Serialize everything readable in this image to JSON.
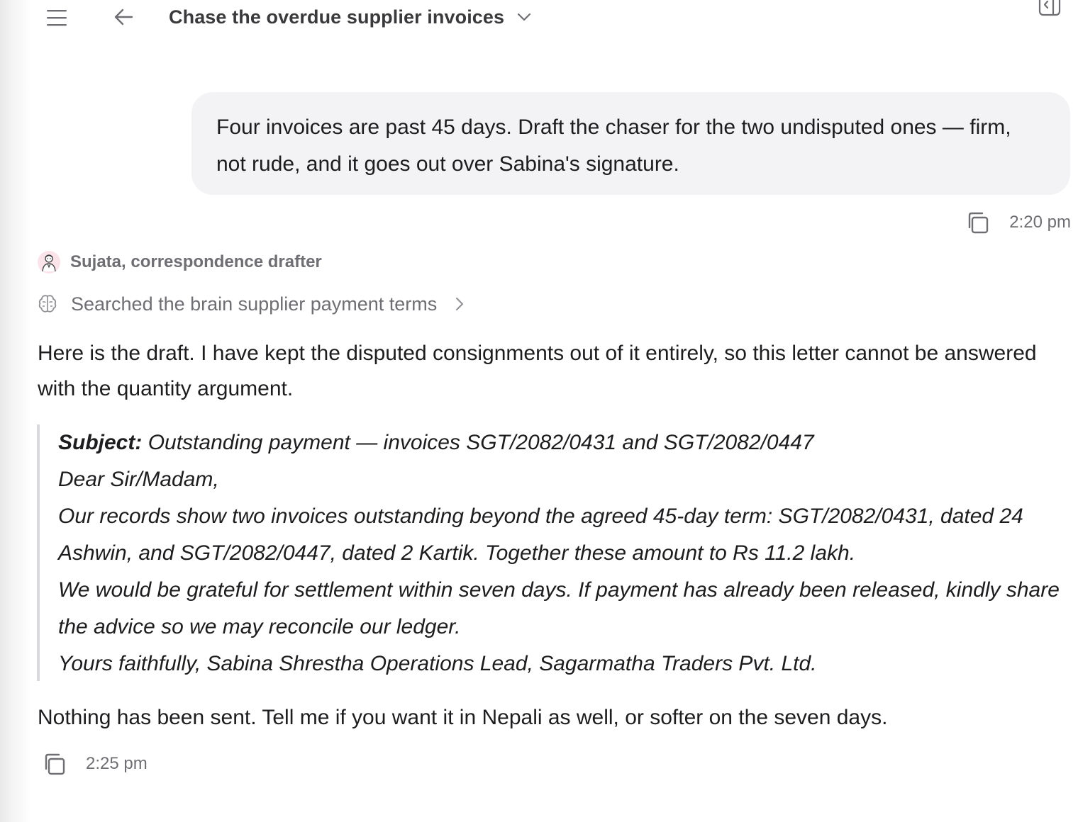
{
  "header": {
    "title": "Chase the overdue supplier invoices",
    "icons": [
      "menu-icon",
      "back-arrow-icon",
      "chevron-down-icon",
      "sidebar-toggle-icon"
    ]
  },
  "user_message": {
    "text": "Four invoices are past 45 days. Draft the chaser for the two undisputed ones — firm, not rude, and it goes out over Sabina's signature.",
    "time": "2:20 pm"
  },
  "assistant": {
    "name": "Sujata, correspondence drafter",
    "tool_call": "Searched the brain supplier payment terms",
    "intro": "Here is the draft. I have kept the disputed consignments out of it entirely, so this letter cannot be answered with the quantity argument.",
    "letter": {
      "subject_label": "Subject:",
      "subject": "Outstanding payment — invoices SGT/2082/0431 and SGT/2082/0447",
      "salutation": "Dear Sir/Madam,",
      "body_1": "Our records show two invoices outstanding beyond the agreed 45-day term: SGT/2082/0431, dated 24 Ashwin, and SGT/2082/0447, dated 2 Kartik. Together these amount to Rs 11.2 lakh.",
      "body_2": "We would be grateful for settlement within seven days. If payment has already been released, kindly share the advice so we may reconcile our ledger.",
      "closing": "Yours faithfully, Sabina Shrestha Operations Lead, Sagarmatha Traders Pvt. Ltd."
    },
    "outro": "Nothing has been sent. Tell me if you want it in Nepali as well, or softer on the seven days.",
    "time": "2:25 pm"
  },
  "colors": {
    "bubble_bg": "#f3f3f5",
    "muted_text": "#6e6e73",
    "quote_border": "#d9d9dc",
    "avatar_bg": "#fbe3ea"
  }
}
